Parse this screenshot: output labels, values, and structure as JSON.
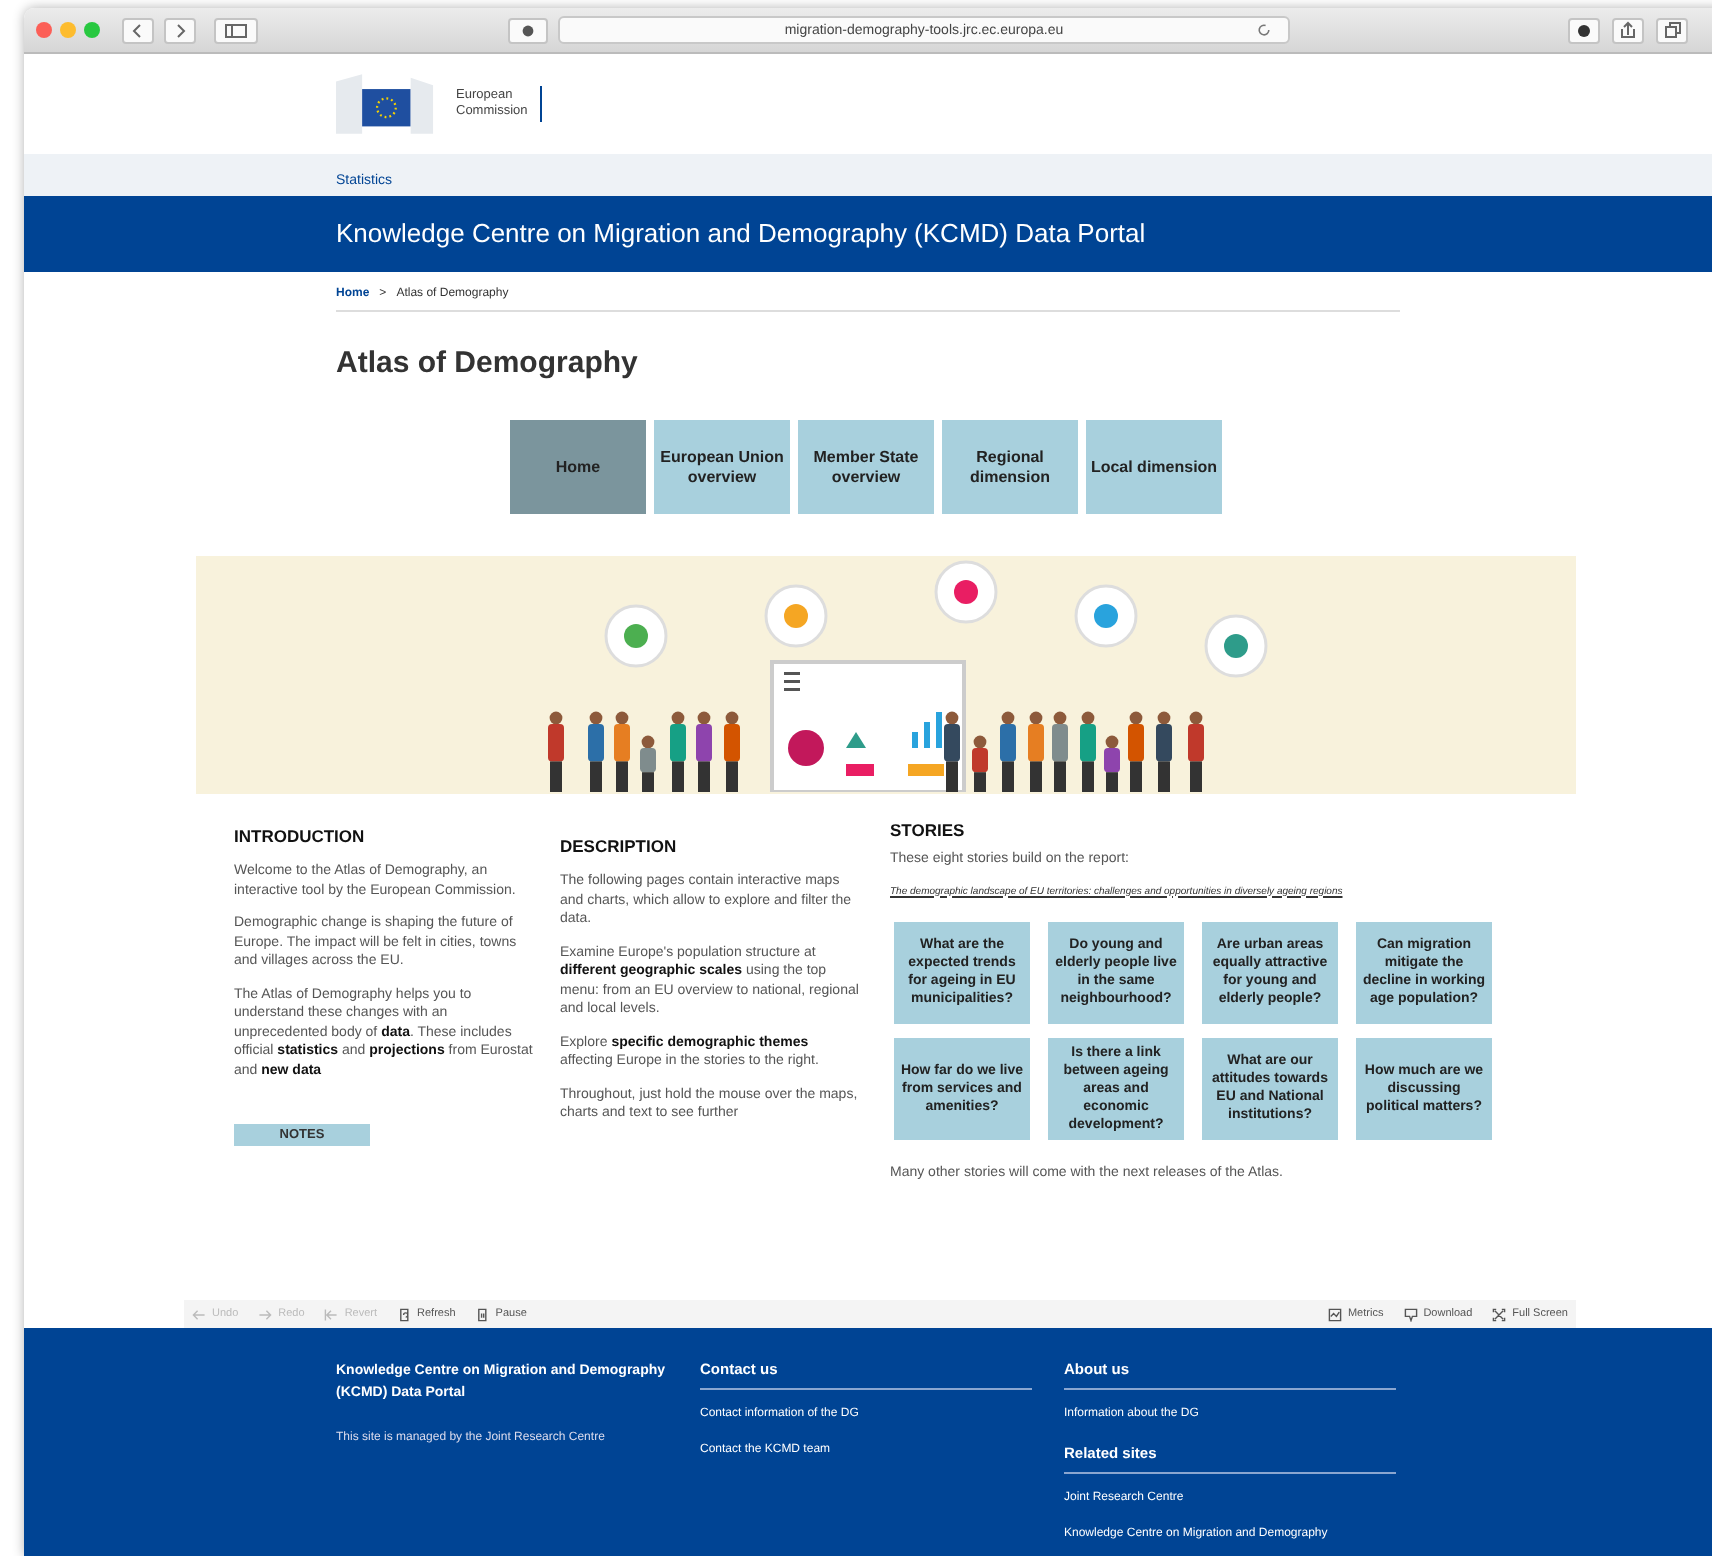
{
  "browser": {
    "url": "migration-demography-tools.jrc.ec.europa.eu"
  },
  "header": {
    "logo_lines": [
      "European",
      "Commission"
    ],
    "section_link": "Statistics",
    "portal_title": "Knowledge Centre on Migration and Demography (KCMD) Data Portal"
  },
  "breadcrumb": [
    {
      "label": "Home",
      "kind": "link"
    },
    {
      "label": ">",
      "kind": "separator"
    },
    {
      "label": "Atlas of Demography",
      "kind": "current"
    }
  ],
  "page_title": "Atlas of Demography",
  "tabs": [
    {
      "label": "Home",
      "selected": true
    },
    {
      "label": "European Union overview",
      "selected": false
    },
    {
      "label": "Member State overview",
      "selected": false
    },
    {
      "label": "Regional dimension",
      "selected": false
    },
    {
      "label": "Local dimension",
      "selected": false
    }
  ],
  "introduction": {
    "heading": "INTRODUCTION",
    "paragraphs": [
      "Welcome to the Atlas of Demography, an interactive tool by the European Commission.",
      "Demographic change is shaping the future of Europe. The impact will be felt in cities, towns and villages across the EU.",
      "The Atlas of Demography helps you to understand these changes with an unprecedented body of **data**. These includes official **statistics** and **projections** from Eurostat and **new data**"
    ],
    "notes_button": "NOTES"
  },
  "description": {
    "heading": "DESCRIPTION",
    "paragraphs": [
      "The following pages contain interactive maps and charts, which allow to explore and filter the data.",
      "Examine Europe's population structure at **different geographic scales** using the top menu: from an EU overview to national, regional and local levels.",
      "Explore **specific demographic themes** affecting Europe in the stories to the right.",
      "Throughout, just hold the mouse over the maps, charts and text to see further"
    ]
  },
  "stories": {
    "heading": "STORIES",
    "intro": "These eight stories build on the report:",
    "report_link": "The demographic landscape of EU territories: challenges and opportunities in diversely ageing regions",
    "cards": [
      "What are the expected trends for ageing in EU municipalities?",
      "Do young and elderly people live in the same neighbourhood?",
      "Are urban areas equally attractive for young and elderly people?",
      "Can migration mitigate the decline in working age population?",
      "How far do we live from services and amenities?",
      "Is there a link between ageing areas and economic development?",
      "What are our attitudes towards EU and National institutions?",
      "How much are we discussing political matters?"
    ],
    "note": "Many other stories will come with the next releases of the Atlas."
  },
  "toolbar": {
    "left": [
      {
        "label": "Undo",
        "kind": "undo",
        "disabled": true
      },
      {
        "label": "Redo",
        "kind": "redo",
        "disabled": true
      },
      {
        "label": "Revert",
        "kind": "revert",
        "disabled": true
      },
      {
        "label": "Refresh",
        "kind": "refresh",
        "disabled": false
      },
      {
        "label": "Pause",
        "kind": "pause",
        "disabled": false
      }
    ],
    "right": [
      {
        "label": "Metrics",
        "kind": "metrics",
        "disabled": false
      },
      {
        "label": "Download",
        "kind": "download",
        "disabled": false
      },
      {
        "label": "Full Screen",
        "kind": "fullscreen",
        "disabled": false
      }
    ]
  },
  "footer": {
    "portal_name": "Knowledge Centre on Migration and Demography (KCMD) Data Portal",
    "managed_by": "This site is managed by the Joint Research Centre",
    "sections": [
      {
        "heading": "Contact us",
        "links": [
          "Contact information of the DG",
          "Contact the KCMD team"
        ]
      },
      {
        "heading": "About us",
        "links": [
          "Information about the DG"
        ]
      },
      {
        "heading": "Related sites",
        "links": [
          "Joint Research Centre",
          "Knowledge Centre on Migration and Demography"
        ]
      }
    ]
  }
}
